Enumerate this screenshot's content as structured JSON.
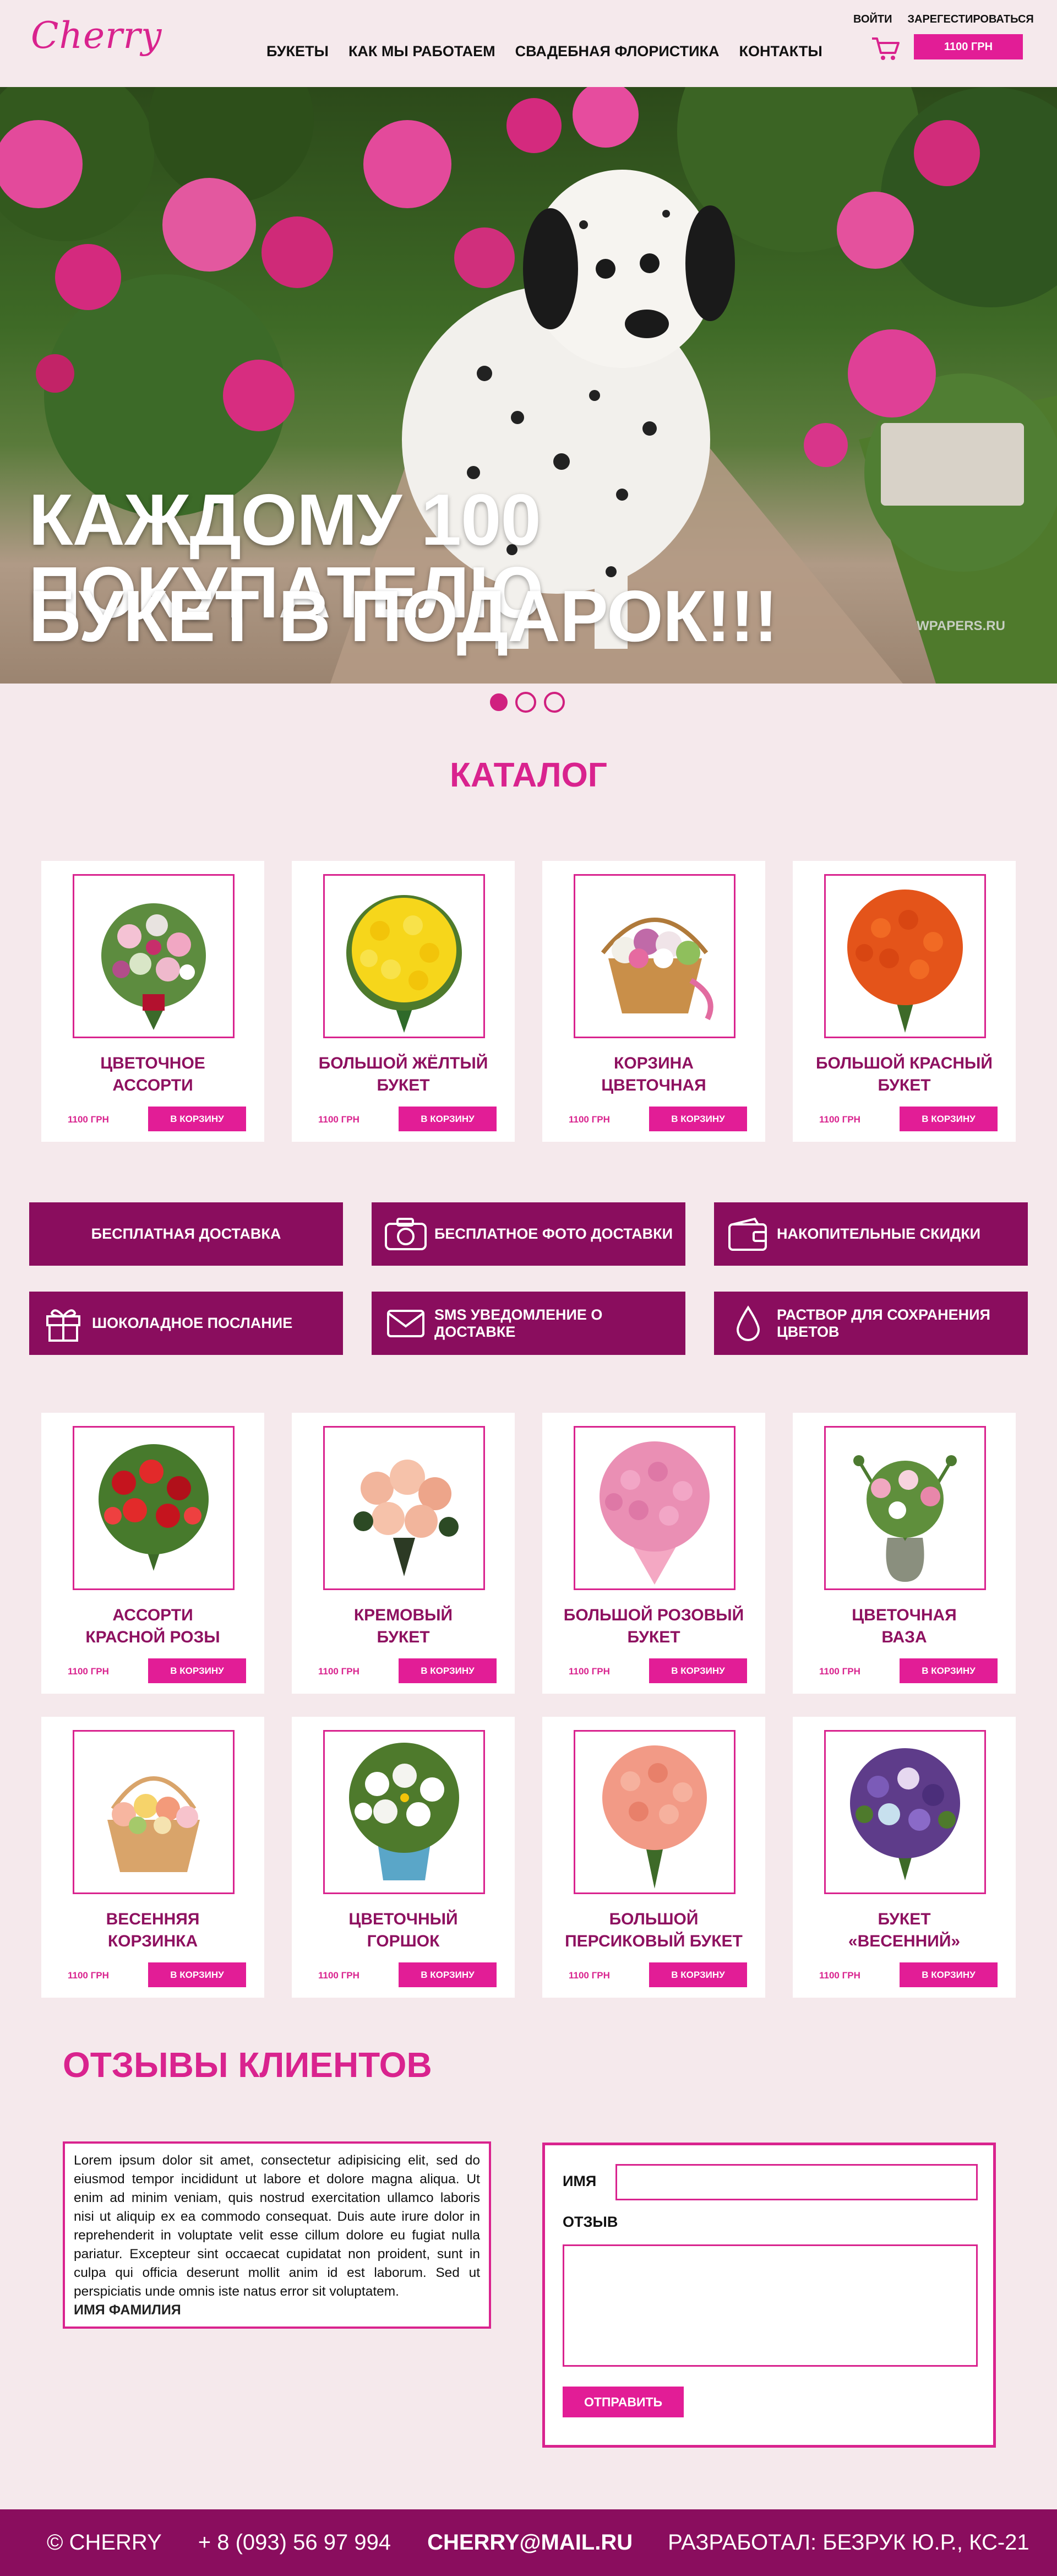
{
  "header": {
    "logo_text": "Cherry",
    "nav": [
      "БУКЕТЫ",
      "КАК МЫ РАБОТАЕМ",
      "СВАДЕБНАЯ ФЛОРИСТИКА",
      "КОНТАКТЫ"
    ],
    "login": "ВОЙТИ",
    "register": "ЗАРЕГЕСТИРОВАТЬСЯ",
    "cart_total": "1100 ГРН"
  },
  "hero": {
    "line1": "КАЖДОМУ 100 ПОКУПАТЕЛЮ",
    "line2": "БУКЕТ В ПОДАРОК!!!",
    "watermark": "WPAPERS.RU",
    "slides": 3,
    "active_slide": 1
  },
  "catalog": {
    "title": "КАТАЛОГ",
    "buy_label": "В КОРЗИНУ",
    "top": [
      {
        "name1": "ЦВЕТОЧНОЕ",
        "name2": "АССОРТИ",
        "price": "1100 ГРН"
      },
      {
        "name1": "БОЛЬШОЙ ЖЁЛТЫЙ",
        "name2": "БУКЕТ",
        "price": "1100 ГРН"
      },
      {
        "name1": "КОРЗИНА",
        "name2": "ЦВЕТОЧНАЯ",
        "price": "1100 ГРН"
      },
      {
        "name1": "БОЛЬШОЙ КРАСНЫЙ",
        "name2": "БУКЕТ",
        "price": "1100 ГРН"
      }
    ],
    "middle": [
      {
        "name1": "АССОРТИ",
        "name2": "КРАСНОЙ РОЗЫ",
        "price": "1100 ГРН"
      },
      {
        "name1": "КРЕМОВЫЙ",
        "name2": "БУКЕТ",
        "price": "1100 ГРН"
      },
      {
        "name1": "БОЛЬШОЙ РОЗОВЫЙ",
        "name2": "БУКЕТ",
        "price": "1100 ГРН"
      },
      {
        "name1": "ЦВЕТОЧНАЯ",
        "name2": "ВАЗА",
        "price": "1100 ГРН"
      }
    ],
    "bottom": [
      {
        "name1": "ВЕСЕННЯЯ",
        "name2": "КОРЗИНКА",
        "price": "1100 ГРН"
      },
      {
        "name1": "ЦВЕТОЧНЫЙ",
        "name2": "ГОРШОК",
        "price": "1100 ГРН"
      },
      {
        "name1": "БОЛЬШОЙ",
        "name2": "ПЕРСИКОВЫЙ БУКЕТ",
        "price": "1100 ГРН"
      },
      {
        "name1": "БУКЕТ",
        "name2": "«ВЕСЕННИЙ»",
        "price": "1100 ГРН"
      }
    ]
  },
  "features": [
    {
      "label": "БЕСПЛАТНАЯ ДОСТАВКА",
      "icon": "none"
    },
    {
      "label": "БЕСПЛАТНОЕ ФОТО ДОСТАВКИ",
      "icon": "camera-icon"
    },
    {
      "label": "НАКОПИТЕЛЬНЫЕ СКИДКИ",
      "icon": "wallet-icon"
    },
    {
      "label": "ШОКОЛАДНОЕ ПОСЛАНИЕ",
      "icon": "gift-icon"
    },
    {
      "label": "SMS УВЕДОМЛЕНИЕ О ДОСТАВКЕ",
      "icon": "envelope-icon"
    },
    {
      "label": "РАСТВОР ДЛЯ СОХРАНЕНИЯ ЦВЕТОВ",
      "icon": "drop-icon"
    }
  ],
  "reviews": {
    "title": "ОТЗЫВЫ КЛИЕНТОВ",
    "text": "Lorem ipsum dolor sit amet, consectetur adipisicing elit, sed do eiusmod tempor incididunt ut labore et dolore magna aliqua. Ut enim ad minim veniam, quis nostrud exercitation ullamco laboris nisi ut aliquip ex ea commodo consequat. Duis aute irure dolor in reprehenderit in voluptate velit esse cillum dolore eu fugiat nulla pariatur. Excepteur sint occaecat cupidatat non proident, sunt in culpa qui officia deserunt mollit anim id est laborum. Sed ut perspiciatis unde omnis iste natus error sit voluptatem.",
    "author": "ИМЯ ФАМИЛИЯ",
    "form": {
      "name_label": "ИМЯ",
      "review_label": "ОТЗЫВ",
      "submit": "ОТПРАВИТЬ",
      "name_value": "",
      "review_value": ""
    }
  },
  "footer": {
    "copyright": "© CHERRY",
    "phone": "+ 8 (093) 56 97 994",
    "email": "CHERRY@MAIL.RU",
    "developer": "РАЗРАБОТАЛ: БЕЗРУК Ю.Р., КС-21"
  },
  "colors": {
    "accent": "#e21d96",
    "dark": "#8a0d5e",
    "background": "#f5e9ec"
  }
}
